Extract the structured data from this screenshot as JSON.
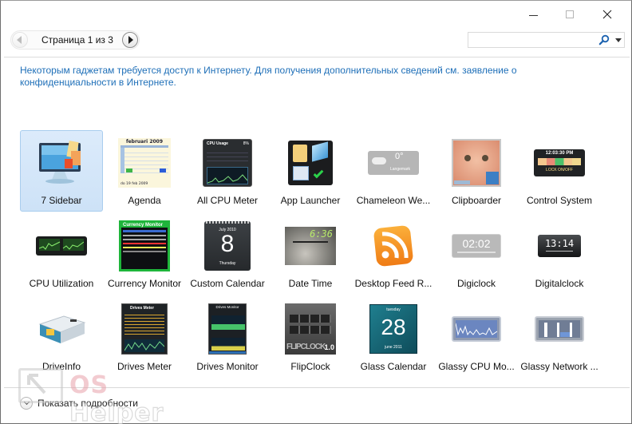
{
  "window": {
    "caption_buttons": [
      "minimize",
      "maximize",
      "close"
    ]
  },
  "pager": {
    "text": "Страница 1 из 3",
    "current_page": 1,
    "total_pages": 3,
    "prev_icon": "arrow-left-icon",
    "next_icon": "arrow-right-icon"
  },
  "search": {
    "value": "",
    "placeholder": "",
    "icon": "search-icon",
    "dropdown_icon": "chevron-down-icon"
  },
  "info_text": "Некоторым гаджетам требуется доступ к Интернету. Для получения дополнительных сведений см. заявление о конфиденциальности в Интернете.",
  "gadgets": [
    {
      "label": "7 Sidebar",
      "selected": true
    },
    {
      "label": "Agenda"
    },
    {
      "label": "All CPU Meter"
    },
    {
      "label": "App Launcher"
    },
    {
      "label": "Chameleon We..."
    },
    {
      "label": "Clipboarder"
    },
    {
      "label": "Control System"
    },
    {
      "label": "CPU Utilization"
    },
    {
      "label": "Currency Monitor"
    },
    {
      "label": "Custom Calendar"
    },
    {
      "label": "Date Time"
    },
    {
      "label": "Desktop Feed R..."
    },
    {
      "label": "Digiclock"
    },
    {
      "label": "Digitalclock"
    },
    {
      "label": "DriveInfo"
    },
    {
      "label": "Drives Meter"
    },
    {
      "label": "Drives Monitor"
    },
    {
      "label": "FlipClock"
    },
    {
      "label": "Glass Calendar"
    },
    {
      "label": "Glassy CPU Mo..."
    },
    {
      "label": "Glassy Network ..."
    }
  ],
  "thumb_text": {
    "agenda_month": "februari 2009",
    "agenda_footer": "do 19 feb 2009",
    "cpu_title": "CPU Usage",
    "cpu_pct": "8%",
    "chameleon_temp": "0°",
    "chameleon_city": "Langemark",
    "control_time": "12:03:30 PM",
    "control_lock": "LOCK ON/OFF",
    "currency_title": "Currency Monitor",
    "calendar_month": "July 2010",
    "calendar_day": "8",
    "calendar_weekday": "Thursday",
    "datetime_time": "6:36",
    "digiclock_time": "02:02",
    "digitalclock_time": "13:14",
    "drivesmeter_title": "Drives Meter",
    "drivesmonitor_title": "Drives Monitor",
    "flipclock_text": "FLIPCLOCK",
    "flipclock_ver": "1.0",
    "glasscal_day": "28",
    "glasscal_weekday": "tuesday",
    "glasscal_month": "june 2011"
  },
  "footer": {
    "details_label": "Показать подробности"
  },
  "watermark": {
    "os": "OS",
    "helper": "Helper"
  }
}
